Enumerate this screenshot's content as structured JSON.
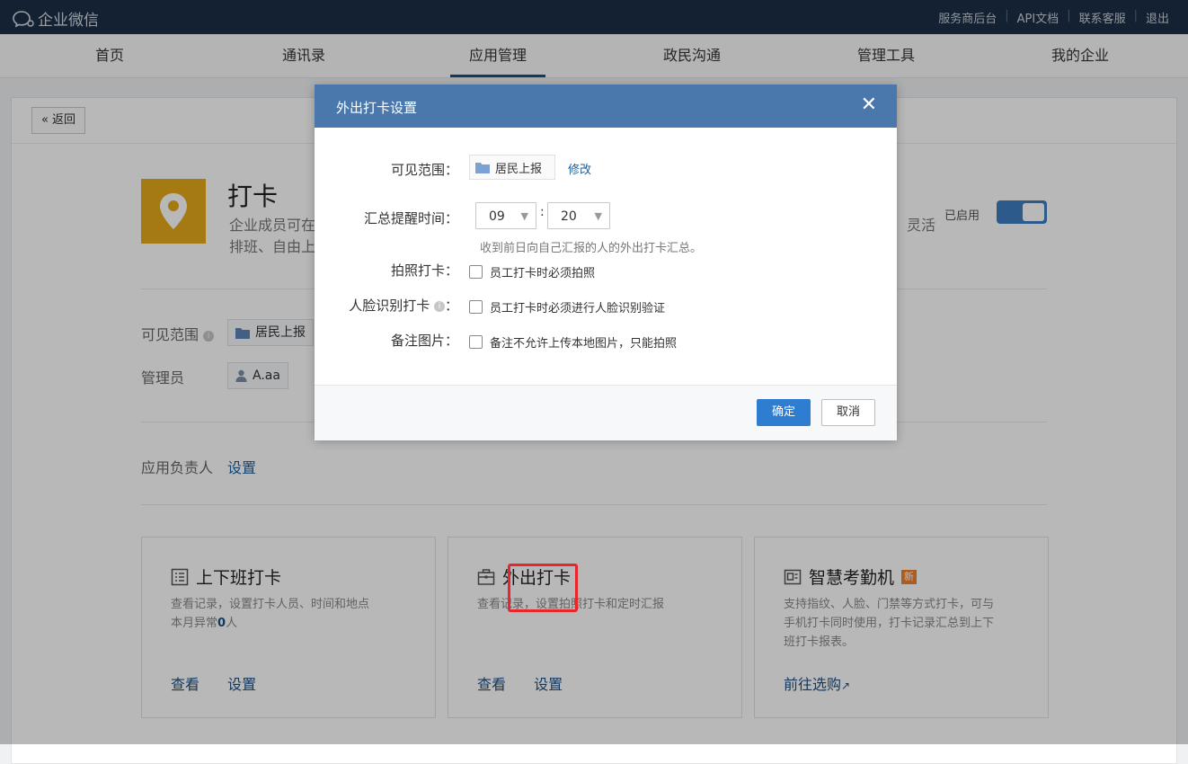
{
  "topbar": {
    "logo_text": "企业微信",
    "links": [
      "服务商后台",
      "API文档",
      "联系客服",
      "退出"
    ]
  },
  "nav": {
    "items": [
      "首页",
      "通讯录",
      "应用管理",
      "政民沟通",
      "管理工具",
      "我的企业"
    ],
    "active": "应用管理"
  },
  "page": {
    "back_label": "返回",
    "app_title": "打卡",
    "app_desc_line1": "企业成员可在",
    "app_desc_line2": "排班、自由上",
    "app_desc_tail": "灵活",
    "enabled_label": "已启用",
    "visible_label": "可见范围",
    "visible_scope": "居民上报",
    "admin_label": "管理员",
    "admin_name": "A.aa",
    "owner_label": "应用负责人",
    "owner_link": "设置"
  },
  "tiles": [
    {
      "title": "上下班打卡",
      "desc_line1": "查看记录，设置打卡人员、时间和地点",
      "desc_line2_prefix": "本月异常",
      "desc_line2_count": "0",
      "desc_line2_suffix": "人",
      "action1": "查看",
      "action2": "设置"
    },
    {
      "title": "外出打卡",
      "desc_line1": "查看记录，设置拍照打卡和定时汇报",
      "action1": "查看",
      "action2": "设置"
    },
    {
      "title": "智慧考勤机",
      "badge": "新",
      "desc_line1": "支持指纹、人脸、门禁等方式打卡，可与",
      "desc_line2": "手机打卡同时使用，打卡记录汇总到上下",
      "desc_line3": "班打卡报表。",
      "action1": "前往选购"
    }
  ],
  "modal": {
    "title": "外出打卡设置",
    "close": "✕",
    "visible_label": "可见范围：",
    "visible_scope": "居民上报",
    "modify_link": "修改",
    "reminder_label": "汇总提醒时间：",
    "hour": "09",
    "minute": "20",
    "time_sep": ":",
    "reminder_hint": "收到前日向自己汇报的人的外出打卡汇总。",
    "photo_label": "拍照打卡：",
    "photo_option": "员工打卡时必须拍照",
    "face_label": "人脸识别打卡",
    "face_suffix": "：",
    "face_option": "员工打卡时必须进行人脸识别验证",
    "note_label": "备注图片：",
    "note_option": "备注不允许上传本地图片，只能拍照",
    "ok": "确定",
    "cancel": "取消"
  },
  "colors": {
    "topbar": "#1d2f46",
    "modal_header": "#4a78ad",
    "primary_button": "#2f7dd1",
    "highlight": "#e8262b",
    "app_icon": "#e5a919"
  }
}
